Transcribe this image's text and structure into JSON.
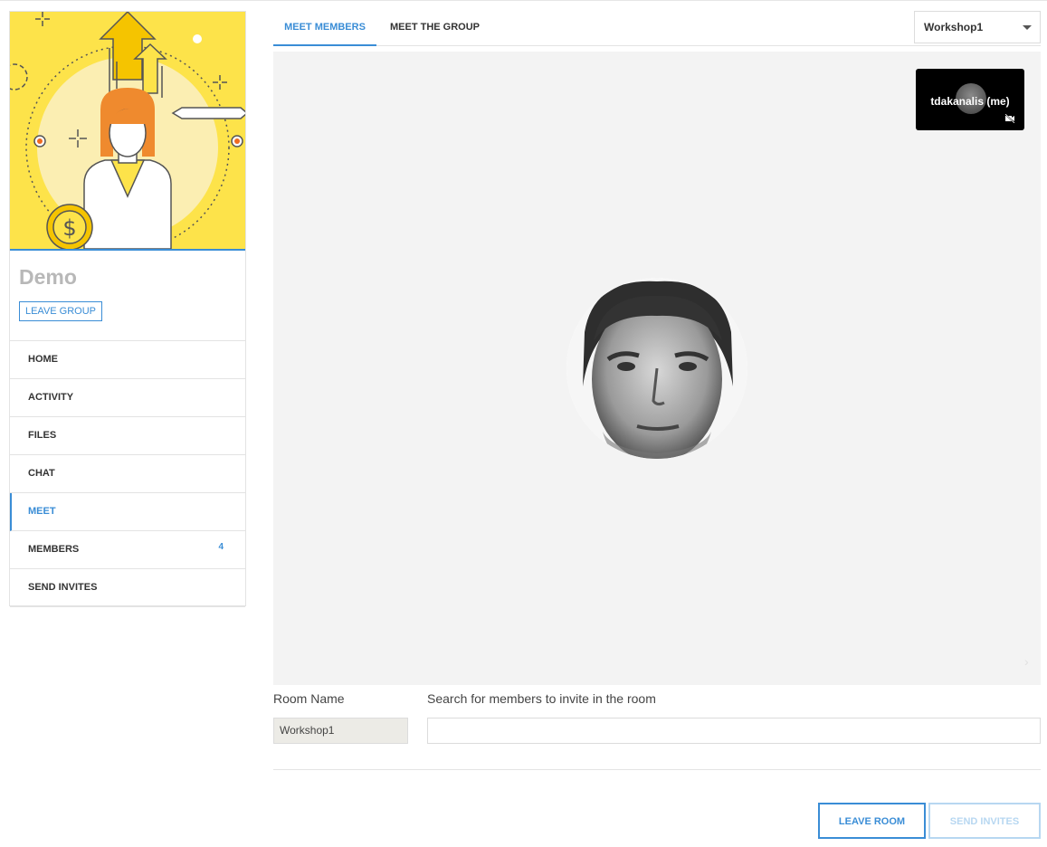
{
  "group": {
    "title": "Demo",
    "leave_label": "LEAVE GROUP"
  },
  "sidebar": {
    "items": [
      {
        "label": "HOME"
      },
      {
        "label": "ACTIVITY"
      },
      {
        "label": "FILES"
      },
      {
        "label": "CHAT"
      },
      {
        "label": "MEET",
        "active": true
      },
      {
        "label": "MEMBERS",
        "count": "4"
      },
      {
        "label": "SEND INVITES"
      }
    ]
  },
  "tabs": [
    {
      "label": "MEET MEMBERS",
      "active": true
    },
    {
      "label": "MEET THE GROUP"
    }
  ],
  "room_select": {
    "selected": "Workshop1"
  },
  "stage": {
    "self_name": "tdakanalis (me)",
    "self_camera_icon": "video-off-icon"
  },
  "form": {
    "room_name_label": "Room Name",
    "room_name_value": "Workshop1",
    "search_label": "Search for members to invite in the room",
    "search_value": ""
  },
  "actions": {
    "leave_room": "LEAVE ROOM",
    "send_invites": "SEND INVITES"
  },
  "colors": {
    "accent": "#3a8dd6",
    "cover_bg": "#fde34a",
    "stage_bg": "#f3f3f3",
    "disabled": "#b7d7f1"
  }
}
